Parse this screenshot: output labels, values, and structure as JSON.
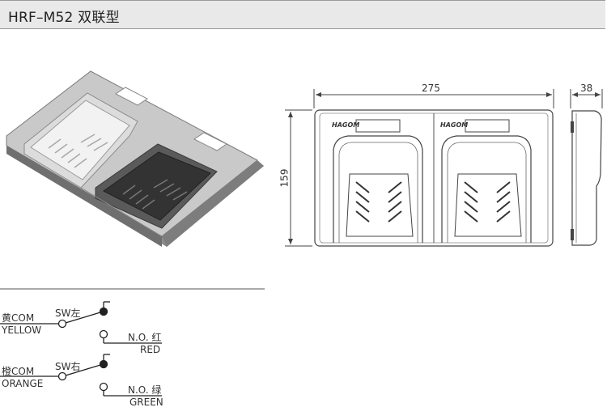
{
  "header": {
    "title": "HRF–M52 双联型"
  },
  "dimensions": {
    "width": "275",
    "depth": "38",
    "height": "159"
  },
  "product": {
    "brand_mark": "HAGOM"
  },
  "wiring": {
    "common1_cn": "黄COM",
    "common1_en": "YELLOW",
    "switch1": "SW左",
    "no1_label": "N.O. 红",
    "no1_en": "RED",
    "common2_cn": "橙COM",
    "common2_en": "ORANGE",
    "switch2": "SW右",
    "no2_label": "N.O. 绿",
    "no2_en": "GREEN"
  }
}
